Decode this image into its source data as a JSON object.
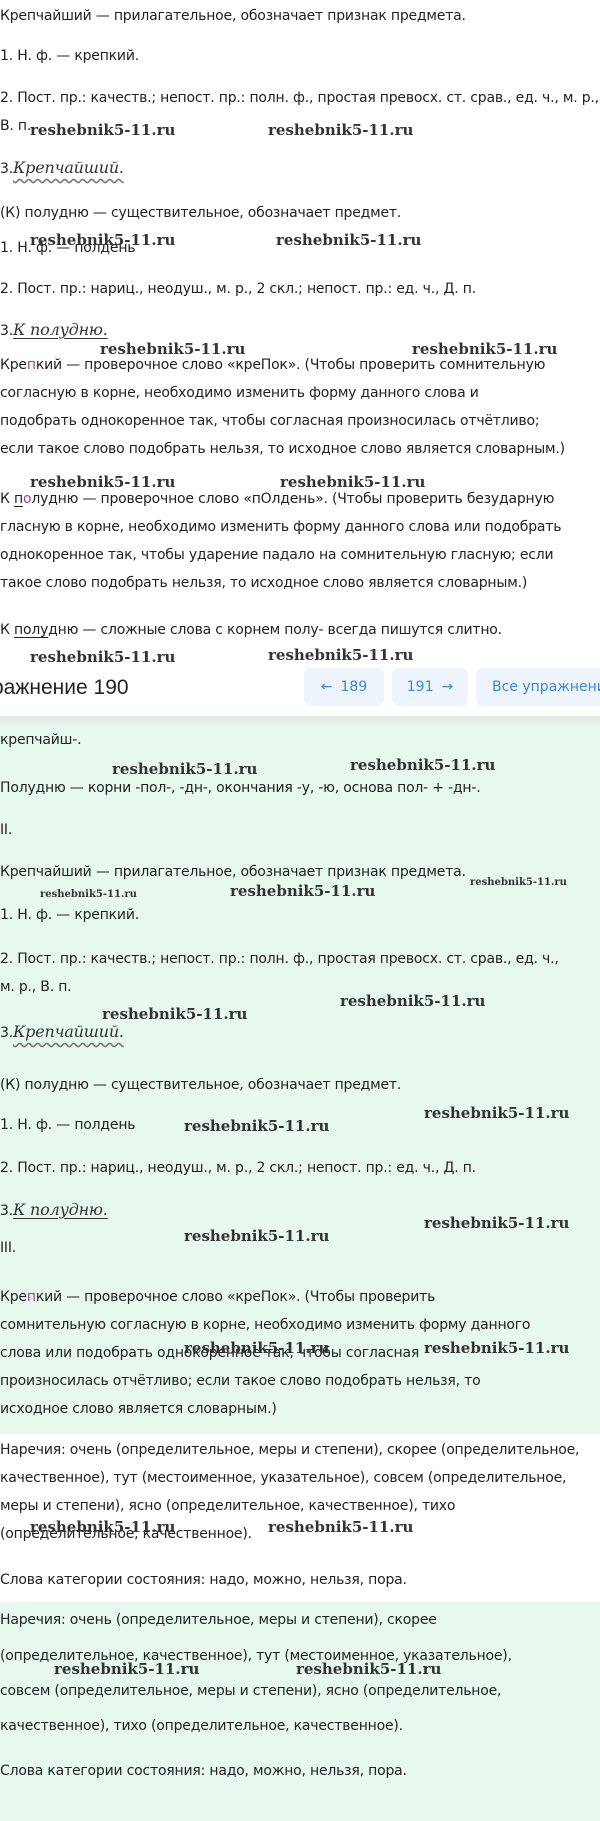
{
  "top": {
    "l1": "Крепчайший — прилагательное, обозначает признак предмета.",
    "l2": "1. Н. ф. — крепкий.",
    "l3": "2. Пост. пр.: качеств.; непост. пр.: полн. ф., простая превосх. ст. срав., ед. ч., м. р.,",
    "l4": "В. п.",
    "l5_num": "3.",
    "l5_word": "Крепчайший.",
    "l6": "(К) полудню — существительное, обозначает предмет.",
    "l7": "1. Н. ф. — полдень",
    "l8": "2. Пост. пр.: нариц., неодуш., м. р., 2 скл.; непост. пр.: ед. ч., Д. п.",
    "l9_num": "3.",
    "l9_word": "К полудню.",
    "l10_a": "Кре",
    "l10_b": "п",
    "l10_c": "кий — проверочное слово «креПок». (Чтобы проверить сомнительную",
    "l11": "согласную в корне, необходимо изменить форму данного слова и",
    "l12": "подобрать однокоренное так, чтобы согласная произносилась отчётливо;",
    "l13": "если такое слово подобрать нельзя, то исходное слово является словарным.)",
    "l14_a": "К ",
    "l14_b": "п",
    "l14_c": "о",
    "l14_d": "лудню — проверочное слово «пОлдень». (Чтобы проверить безударную",
    "l15": "гласную в корне, необходимо изменить форму данного слова или подобрать",
    "l16": "однокоренное так, чтобы ударение падало на сомнительную гласную; если",
    "l17": "такое слово подобрать нельзя, то исходное слово является словарным.)",
    "l18_a": "К ",
    "l18_b": "полу",
    "l18_c": "дню — сложные слова с корнем полу- всегда пишутся слитно."
  },
  "nav": {
    "title": "ражнение 190",
    "prev_arrow": "←",
    "prev": "189",
    "next": "191",
    "next_arrow": "→",
    "all": "Все упражнени"
  },
  "green1": {
    "l1": "крепчайш-.",
    "l2": "Полудню — корни -пол-, -дн-, окончания -у, -ю, основа пол- + -дн-.",
    "l3": "II.",
    "l4": "Крепчайший — прилагательное, обозначает признак предмета.",
    "l5": "1. Н. ф. — крепкий.",
    "l6": "2. Пост. пр.: качеств.; непост. пр.: полн. ф., простая превосх. ст. срав., ед. ч.,",
    "l7": "м. р., В. п.",
    "l8_num": "3.",
    "l8_word": "Крепчайший.",
    "l9": "(К) полудню — существительное, обозначает предмет.",
    "l10": "1. Н. ф. — полдень",
    "l11": "2. Пост. пр.: нариц., неодуш., м. р., 2 скл.; непост. пр.: ед. ч., Д. п.",
    "l12_num": "3.",
    "l12_word": "К полудню.",
    "l13": "III.",
    "l14_a": "Кре",
    "l14_b": "п",
    "l14_c": "кий — проверочное слово «креПок». (Чтобы проверить",
    "l15": "сомнительную согласную в корне, необходимо изменить форму данного",
    "l16": "слова или подобрать однокоренное так, чтобы согласная",
    "l17": "произносилась отчётливо; если такое слово подобрать нельзя, то",
    "l18": "исходное слово является словарным.)"
  },
  "white2": {
    "l1": "Наречия: очень (определительное, меры и степени), скорее (определительное,",
    "l2": "качественное), тут (местоименное, указательное), совсем (определительное,",
    "l3": "меры и степени), ясно (определительное, качественное), тихо",
    "l4": "(определительное, качественное).",
    "l5": "Слова категории состояния: надо, можно, нельзя, пора."
  },
  "green2": {
    "l1": "Наречия: очень (определительное, меры и степени), скорее",
    "l2": "(определительное, качественное), тут (местоименное, указательное),",
    "l3": "совсем (определительное, меры и степени), ясно (определительное,",
    "l4": "качественное), тихо (определительное, качественное).",
    "l5": "Слова категории состояния: надо, можно, нельзя, пора."
  },
  "watermark": "reshebnik5-11.ru"
}
